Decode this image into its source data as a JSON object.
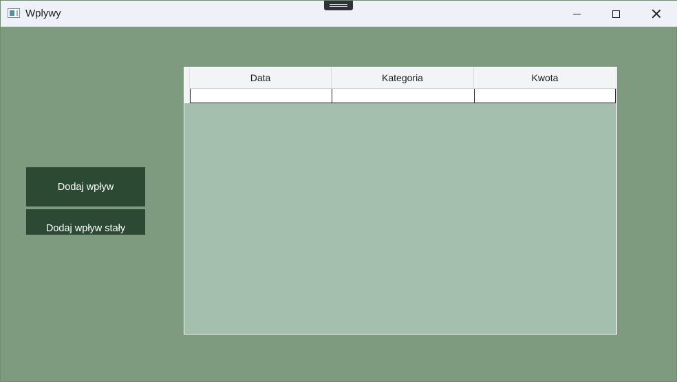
{
  "window": {
    "title": "Wplywy"
  },
  "title_controls": {
    "minimize": "minimize",
    "maximize": "maximize",
    "close": "close"
  },
  "buttons": {
    "add_income": "Dodaj wpływ",
    "add_fixed_income": "Dodaj wpływ stały"
  },
  "grid": {
    "columns": [
      "Data",
      "Kategoria",
      "Kwota"
    ],
    "rows": [
      [
        "",
        "",
        ""
      ]
    ]
  },
  "colors": {
    "background": "#7e9b7f",
    "button": "#2c4a33",
    "grid_body": "#a4bfae"
  },
  "icons": [
    "app-window-icon",
    "minimize-icon",
    "maximize-icon",
    "close-icon"
  ]
}
